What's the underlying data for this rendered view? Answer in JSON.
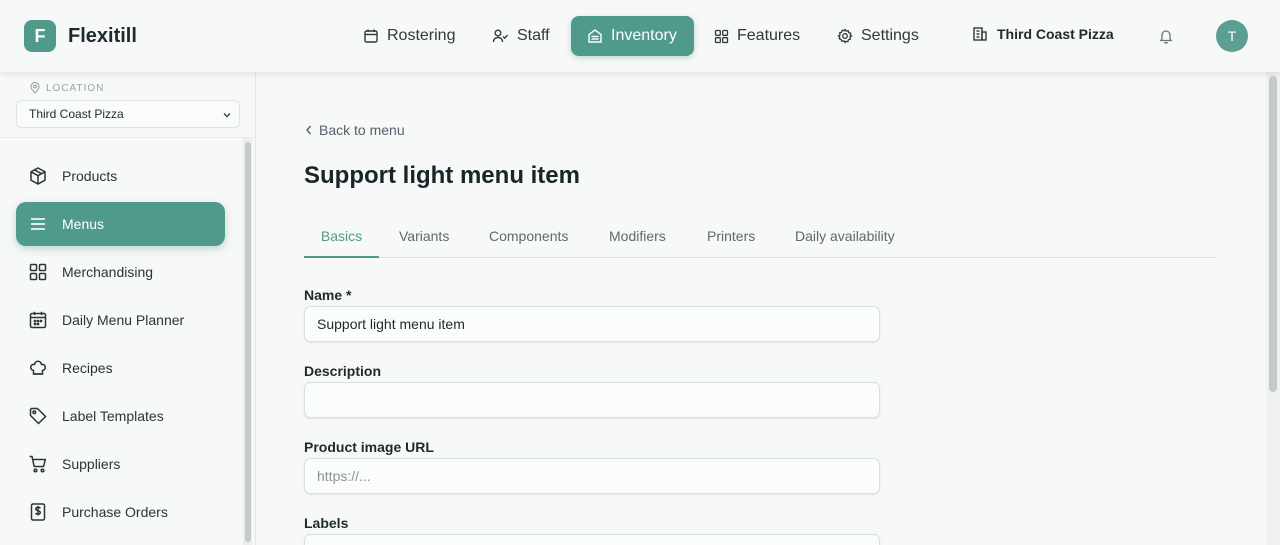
{
  "app": {
    "logo_letter": "F",
    "name": "Flexitill"
  },
  "topnav": {
    "items": [
      {
        "label": "Rostering",
        "icon": "calendar-icon"
      },
      {
        "label": "Staff",
        "icon": "users-icon"
      },
      {
        "label": "Inventory",
        "icon": "inventory-icon",
        "active": true
      },
      {
        "label": "Features",
        "icon": "grid-icon"
      },
      {
        "label": "Settings",
        "icon": "gear-icon"
      }
    ],
    "location_name": "Third Coast Pizza",
    "notification_icon": "bell-icon",
    "avatar_letter": "T"
  },
  "sidebar": {
    "location_label": "LOCATION",
    "location_value": "Third Coast Pizza",
    "items": [
      {
        "label": "Products",
        "icon": "box-icon"
      },
      {
        "label": "Menus",
        "icon": "menu-lines-icon",
        "active": true
      },
      {
        "label": "Merchandising",
        "icon": "grid-icon"
      },
      {
        "label": "Daily Menu Planner",
        "icon": "calendar-icon"
      },
      {
        "label": "Recipes",
        "icon": "chef-hat-icon"
      },
      {
        "label": "Label Templates",
        "icon": "tag-icon"
      },
      {
        "label": "Suppliers",
        "icon": "cart-icon"
      },
      {
        "label": "Purchase Orders",
        "icon": "receipt-dollar-icon"
      }
    ]
  },
  "main": {
    "back_label": "Back to menu",
    "title": "Support light menu item",
    "tabs": [
      "Basics",
      "Variants",
      "Components",
      "Modifiers",
      "Printers",
      "Daily availability"
    ],
    "active_tab": "Basics",
    "fields": {
      "name_label": "Name *",
      "name_value": "Support light menu item",
      "description_label": "Description",
      "description_value": "",
      "image_label": "Product image URL",
      "image_placeholder": "https://...",
      "labels_label": "Labels"
    }
  },
  "colors": {
    "accent": "#4f9a8b",
    "background": "#f7f8f8",
    "text": "#1f2a2e"
  }
}
